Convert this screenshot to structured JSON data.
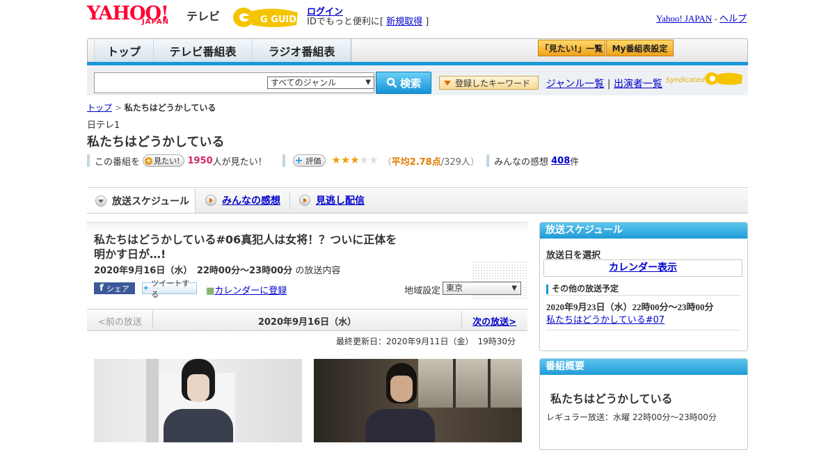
{
  "header": {
    "yahoo": "YAHOO!",
    "japan": "JAPAN",
    "tv": "テレビ",
    "gguide": "G GUIDE",
    "login": "ログイン",
    "login_sub_prefix": "IDでもっと便利に[ ",
    "signup": "新規取得",
    "login_sub_suffix": " ]",
    "yahoo_japan_link": "Yahoo! JAPAN",
    "dash": " - ",
    "help_link": "ヘルプ"
  },
  "nav": {
    "tabs": [
      "トップ",
      "テレビ番組表",
      "ラジオ番組表"
    ],
    "mitai_list": "「見たい!」一覧",
    "my_schedule": "My番組表設定"
  },
  "search": {
    "placeholder": "",
    "genre": "すべてのジャンル",
    "button": "検索",
    "keyword_button": "登録したキーワード",
    "genre_list": "ジャンル一覧",
    "divider": "|",
    "performer_list": "出演者一覧",
    "syndicated": "Syndicated"
  },
  "breadcrumb": {
    "top": "トップ",
    "sep": " > ",
    "current": "私たちはどうかしている"
  },
  "program": {
    "channel": "日テレ1",
    "title": "私たちはどうかしている",
    "mitai_prefix": "この番組を",
    "mitai_button": "見たい!",
    "mitai_count": "1950",
    "mitai_suffix": "人が見たい！",
    "rate_button": "評価",
    "rating_open": "（",
    "rating_avg": "平均2.78点",
    "rating_count": "/329人",
    "rating_close": "）",
    "impressions_prefix": "みんなの感想",
    "impressions_count": "408",
    "impressions_suffix": "件"
  },
  "tabs": {
    "schedule": "放送スケジュール",
    "impressions": "みんなの感想",
    "catchup": "見逃し配信"
  },
  "episode": {
    "title": "私たちはどうかしている#06真犯人は女将！？ついに正体を明かす日が…!",
    "datetime": "2020年9月16日（水）　22時00分～23時00分",
    "datetime_suffix": "の放送内容",
    "share": "シェア",
    "tweet": "ツイートする",
    "calendar_register": "カレンダーに登録",
    "region_label": "地域設定",
    "region": "東京"
  },
  "pager": {
    "prev": "<前の放送",
    "date": "2020年9月16日（水）",
    "next": "次の放送>"
  },
  "updated": "最終更新日：2020年9月11日（金）　19時30分",
  "sidebar": {
    "schedule": {
      "head": "放送スケジュール",
      "select_date": "放送日を選択",
      "calendar": "カレンダー表示",
      "other_head": "その他の放送予定",
      "other_datetime": "2020年9月23日（水）22時00分～23時00分",
      "other_link": "私たちはどうかしている#07"
    },
    "overview": {
      "head": "番組概要",
      "title": "私たちはどうかしている",
      "regular": "レギュラー放送：水曜 22時00分～23時00分"
    }
  },
  "colors": {
    "accent_blue": "#1898d8",
    "pink_count": "#d6246b",
    "orange": "#e07b00",
    "star": "#e8a200"
  },
  "rating_stars": 2.78
}
